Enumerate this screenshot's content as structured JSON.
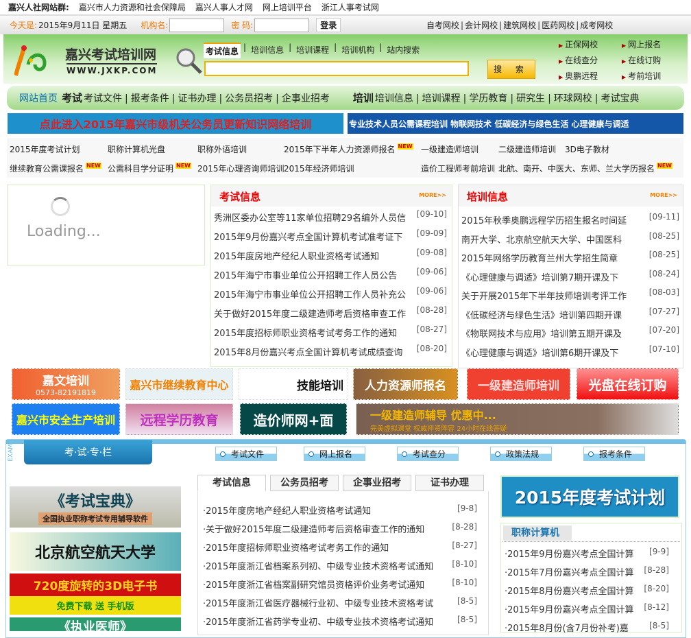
{
  "topbar": {
    "label": "嘉兴人社网站群:",
    "links": [
      "嘉兴市人力资源和社会保障局",
      "嘉兴人事人才网",
      "网上培训平台",
      "浙江人事考试网"
    ]
  },
  "bar2": {
    "today_label": "今天是:",
    "date": "2015年9月11日 星期五",
    "org_label": "机构名:",
    "pwd_label": "密 码:",
    "login": "登录",
    "schools": [
      "自考网校",
      "会计网校",
      "建筑网校",
      "医药网校",
      "成考网校"
    ]
  },
  "logo": {
    "title": "嘉兴考试培训网",
    "url": "WWW.JXKP.COM"
  },
  "search": {
    "tabs": [
      "考试信息",
      "培训信息",
      "培训课程",
      "培训机构",
      "站内搜索"
    ],
    "value": "",
    "button": "搜 索"
  },
  "quick": [
    "正保网校",
    "网上报名",
    "在线查分",
    "在线订购",
    "奥鹏远程",
    "考前培训"
  ],
  "nav": {
    "home": "网站首页",
    "exam": "考试",
    "exam_items": [
      "考试文件",
      "报考条件",
      "证书办理",
      "公务员招考",
      "企事业招考"
    ],
    "train": "培训",
    "train_items": [
      "培训信息",
      "培训课程",
      "学历教育",
      "研究生",
      "环球网校",
      "考试宝典"
    ]
  },
  "banners": {
    "left": "点此进入2015年嘉兴市级机关公务员更新知识网络培训",
    "right": "专业技术人员公需课程培训 物联网技术 低碳经济与绿色生活 心理健康与调适"
  },
  "links": {
    "new": "NEW",
    "row1": [
      "2015年度考试计划",
      "职称计算机光盘",
      "职称外语培训",
      "2015年下半年人力资源师报名",
      "一级建造师培训",
      "二级建造师培训",
      "3D电子教材"
    ],
    "row2": [
      "继续教育公需课报名",
      "公需科目学分证明",
      "2015年心理咨询师培训",
      "2015年经济师培训",
      "造价工程师考前培训",
      "北航、南开、中医大、东师、兰大学历报名"
    ]
  },
  "loading": "Loading...",
  "exam_info": {
    "title": "考试信息",
    "more": "MORE>>",
    "items": [
      {
        "t": "秀洲区委办公室等11家单位招聘29名编外人员信",
        "d": "[09-10]"
      },
      {
        "t": "2015年9月份嘉兴考点全国计算机考试准考证下",
        "d": "[09-09]"
      },
      {
        "t": "2015年度房地产经纪人职业资格考试通知",
        "d": "[09-08]"
      },
      {
        "t": "2015年海宁市事业单位公开招聘工作人员公告",
        "d": "[09-06]"
      },
      {
        "t": "2015年海宁市事业单位公开招聘工作人员补充公",
        "d": "[09-06]"
      },
      {
        "t": "关于做好2015年度二级建造师考后资格审查工作",
        "d": "[08-28]"
      },
      {
        "t": "2015年度招标师职业资格考试考务工作的通知",
        "d": "[08-27]"
      },
      {
        "t": "2015年8月份嘉兴考点全国计算机考试成绩查询",
        "d": "[08-20]"
      }
    ]
  },
  "train_info": {
    "title": "培训信息",
    "more": "MORE>>",
    "items": [
      {
        "t": "2015年秋季奥鹏远程学历招生报名时间延",
        "d": "[09-11]"
      },
      {
        "t": "南开大学、北京航空航天大学、中国医科",
        "d": "[08-25]"
      },
      {
        "t": "2015年网络学历教育兰州大学招生简章",
        "d": "[08-25]"
      },
      {
        "t": "《心理健康与调适》培训第7期开课及下",
        "d": "[08-24]"
      },
      {
        "t": "关于开展2015年下半年技师培训考评工作",
        "d": "[08-03]"
      },
      {
        "t": "《低碳经济与绿色生活》培训第四期开课",
        "d": "[07-27]"
      },
      {
        "t": "《物联网技术与应用》培训第五期开课及",
        "d": "[07-20]"
      },
      {
        "t": "《心理健康与调适》培训第6期开课及下",
        "d": "[07-10]"
      }
    ]
  },
  "ads": {
    "row1": [
      "嘉文培训",
      "0573-82191819",
      "嘉兴市继续教育中心",
      "技能培训",
      "人力资源师报名",
      "一级建造师培训",
      "光盘在线订购"
    ],
    "row2": [
      "嘉兴市安全生产培训",
      "远程学历教育",
      "造价师网+面",
      "一级建造师辅导 优惠中...",
      "完美虚拟课堂 权威师资阵容 24小时在线答疑"
    ]
  },
  "exam_section": {
    "side": "EXAM",
    "title": "考·试·专·栏",
    "buttons": [
      "考试文件",
      "网上报名",
      "考试查分",
      "政策法规",
      "报考条件"
    ]
  },
  "left_images": [
    "《考试宝典》",
    "全国执业职称考试专用辅导软件",
    "北京航空航天大学",
    "720度旋转的3D电子书",
    "免费下载 送 手机版",
    "《执业医师》"
  ],
  "tabs": {
    "labels": [
      "考试信息",
      "公务员招考",
      "企事业招考",
      "证书办理"
    ],
    "items": [
      {
        "t": "·2015年度房地产经纪人职业资格考试通知",
        "d": "[9-8]"
      },
      {
        "t": "·关于做好2015年度二级建造师考后资格审查工作的通知",
        "d": "[8-28]"
      },
      {
        "t": "·2015年度招标师职业资格考试考务工作的通知",
        "d": "[8-27]"
      },
      {
        "t": "·2015年度浙江省档案系列初、中级专业技术资格考试通知",
        "d": "[8-10]"
      },
      {
        "t": "·2015年度浙江省档案副研究馆员资格评价业务考试通知",
        "d": "[8-10]"
      },
      {
        "t": "·2015年度浙江省医疗器械行业初、中级专业技术资格考试",
        "d": "[8-5]"
      },
      {
        "t": "·2015年度浙江省药学专业初、中级专业技术资格考试通知",
        "d": "[8-5]"
      }
    ]
  },
  "plan_banner": "2015年度考试计划",
  "computer": {
    "title": "职称计算机",
    "items": [
      {
        "t": "·2015年9月份嘉兴考点全国计算",
        "d": "[9-9]"
      },
      {
        "t": "·2015年7月份嘉兴考点全国计算",
        "d": "[8-28]"
      },
      {
        "t": "·2015年8月份嘉兴考点全国计算",
        "d": "[8-20]"
      },
      {
        "t": "·2015年9月份嘉兴考点全国计算",
        "d": "[8-12]"
      },
      {
        "t": "·2015年8月份(含7月份补考)嘉",
        "d": "[8-5]"
      }
    ]
  }
}
